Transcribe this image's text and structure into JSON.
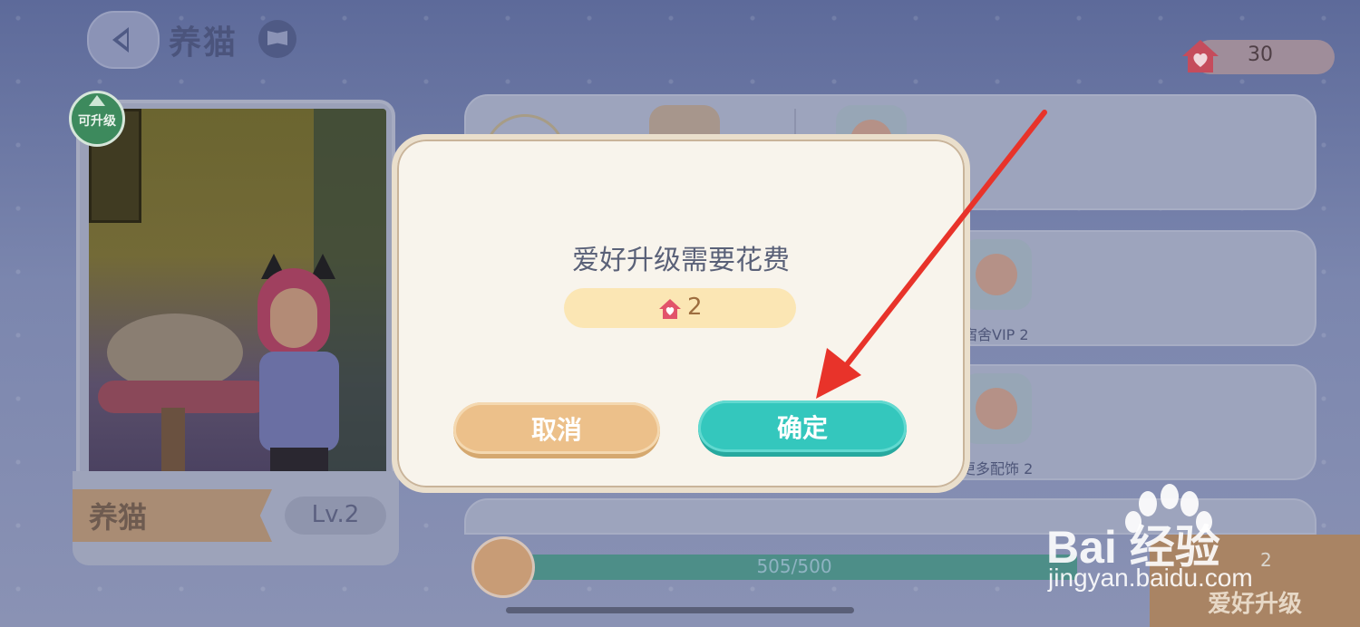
{
  "header": {
    "title": "养猫",
    "currency_value": "30"
  },
  "card": {
    "badge": "可升级",
    "name": "养猫",
    "level": "Lv.2"
  },
  "list": {
    "item2_label": "宿舍VIP 2",
    "item3_label": "更多配饰 2"
  },
  "progress": {
    "text": "505/500",
    "fraction": 1.0
  },
  "upgrade": {
    "cost": "2",
    "label": "爱好升级"
  },
  "dialog": {
    "title": "爱好升级需要花费",
    "cost": "2",
    "cancel_label": "取消",
    "confirm_label": "确定"
  },
  "watermark": {
    "brand": "Bai 经验",
    "url": "jingyan.baidu.com"
  },
  "colors": {
    "confirm": "#34c7bd",
    "cancel": "#ecc08a",
    "arrow": "#e8332a",
    "currency": "#e2546a"
  }
}
